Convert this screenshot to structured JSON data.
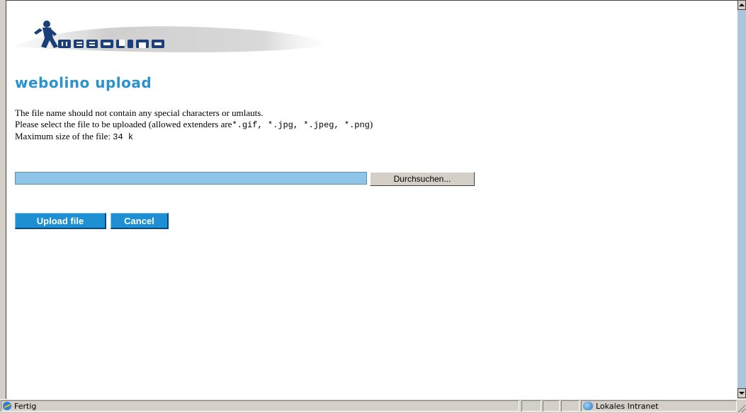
{
  "logo": {
    "text": "WEBOLINO"
  },
  "page": {
    "title": "webolino upload",
    "line1": "The file name should not contain any special characters or umlauts.",
    "line2_prefix": "Please select the file to be uploaded (allowed extenders are",
    "line2_exts": "*.gif, *.jpg, *.jpeg, *.png",
    "line2_suffix": ")",
    "line3_prefix": "Maximum size of the file: ",
    "line3_size": "34 k"
  },
  "file_input": {
    "value": ""
  },
  "buttons": {
    "browse": "Durchsuchen...",
    "upload": "Upload file",
    "cancel": "Cancel"
  },
  "statusbar": {
    "status": "Fertig",
    "zone": "Lokales Intranet"
  },
  "colors": {
    "title": "#2a92cc",
    "button": "#1e8fd2",
    "input_bg": "#8ec4e8"
  }
}
